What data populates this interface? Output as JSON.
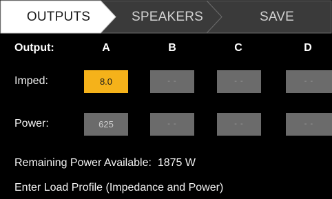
{
  "tabs": [
    {
      "label": "OUTPUTS",
      "active": true
    },
    {
      "label": "SPEAKERS",
      "active": false
    },
    {
      "label": "SAVE",
      "active": false
    }
  ],
  "grid": {
    "header_label": "Output:",
    "columns": [
      "A",
      "B",
      "C",
      "D"
    ],
    "rows": [
      {
        "label": "Imped:",
        "values": [
          "8.0",
          "- -",
          "- -",
          "- -"
        ]
      },
      {
        "label": "Power:",
        "values": [
          "625",
          "- -",
          "- -",
          "- -"
        ]
      }
    ]
  },
  "remaining": {
    "label": "Remaining Power Available:",
    "value": "1875 W"
  },
  "instruction": "Enter Load Profile (Impedance and Power)",
  "colors": {
    "selected_cell": "#f5b21a",
    "cell": "#6b6b6b",
    "active_tab": "#ffffff",
    "inactive_tab": "#3a3a3a",
    "background": "#000000"
  }
}
